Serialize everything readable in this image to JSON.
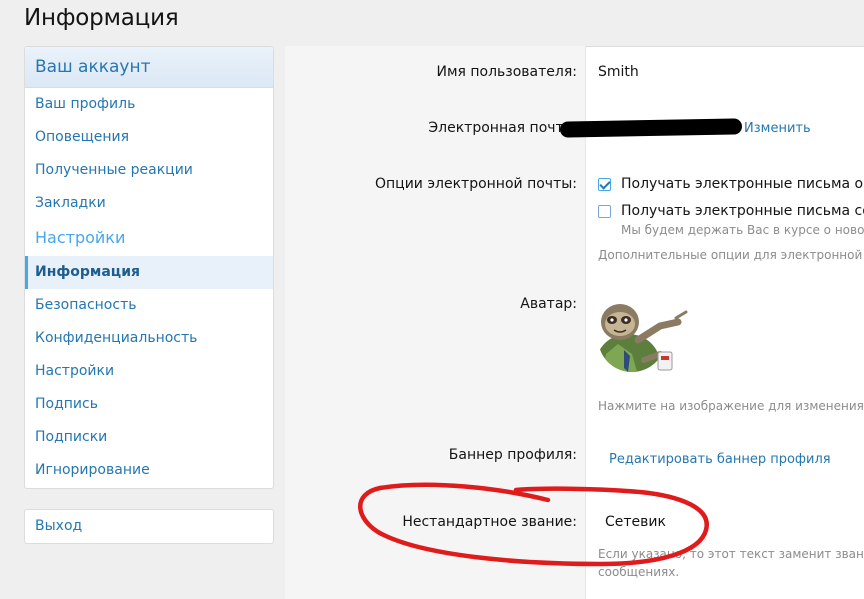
{
  "page": {
    "title": "Информация"
  },
  "sidebar": {
    "header": "Ваш аккаунт",
    "items_top": [
      {
        "label": "Ваш профиль"
      },
      {
        "label": "Оповещения"
      },
      {
        "label": "Полученные реакции"
      },
      {
        "label": "Закладки"
      }
    ],
    "section": "Настройки",
    "items_settings": [
      {
        "label": "Информация",
        "active": true
      },
      {
        "label": "Безопасность"
      },
      {
        "label": "Конфиденциальность"
      },
      {
        "label": "Настройки"
      },
      {
        "label": "Подпись"
      },
      {
        "label": "Подписки"
      },
      {
        "label": "Игнорирование"
      }
    ],
    "logout": "Выход"
  },
  "form": {
    "username": {
      "label": "Имя пользователя:",
      "value": "Smith"
    },
    "email": {
      "label": "Электронная почта:",
      "change_link": "Изменить"
    },
    "email_options": {
      "label": "Опции электронной почты:",
      "option1": {
        "label": "Получать электронные письма о но",
        "checked": true
      },
      "option2": {
        "label": "Получать электронные письма со с",
        "checked": false
      },
      "option2_hint": "Мы будем держать Вас в курсе о новом",
      "extra_hint": "Дополнительные опции для электронной по"
    },
    "avatar": {
      "label": "Аватар:",
      "hint": "Нажмите на изображение для изменения св"
    },
    "banner": {
      "label": "Баннер профиля:",
      "edit_link": "Редактировать баннер профиля"
    },
    "custom_title": {
      "label": "Нестандартное звание:",
      "value": "Сетевик",
      "hint_line1": "Если указано, то этот текст заменит звание, к",
      "hint_line2": "сообщениях."
    }
  },
  "colors": {
    "accent": "#2577b1",
    "accent_light": "#47a7eb",
    "annotation": "#e01b1b"
  }
}
